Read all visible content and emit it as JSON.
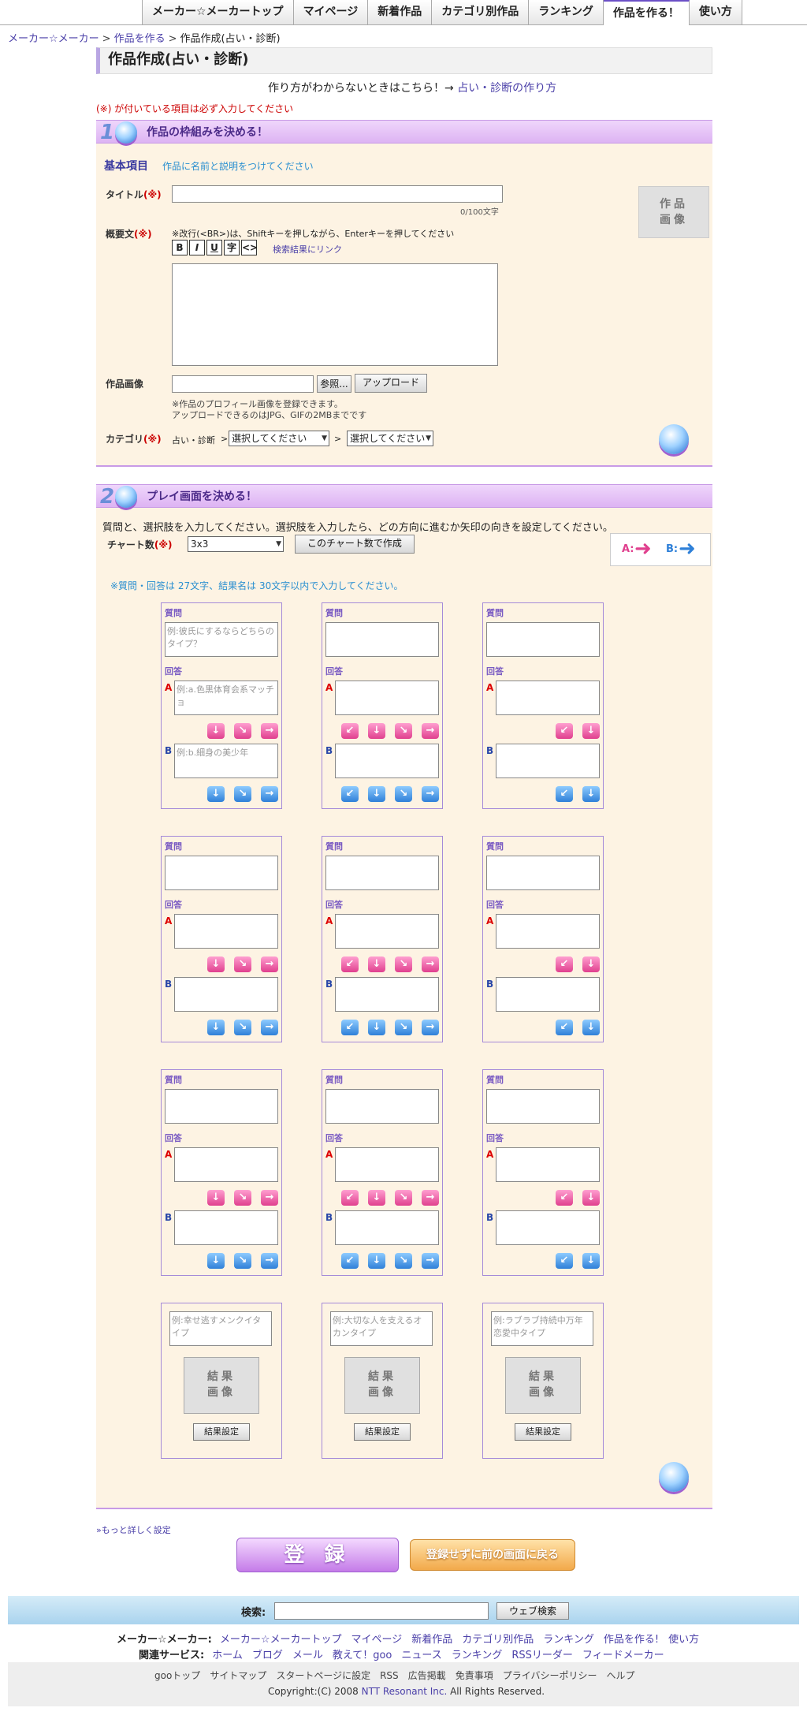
{
  "nav": {
    "tabs": [
      "メーカー☆メーカートップ",
      "マイページ",
      "新着作品",
      "カテゴリ別作品",
      "ランキング",
      "作品を作る！",
      "使い方"
    ],
    "active_index": 5
  },
  "breadcrumb": {
    "items": [
      "メーカー☆メーカー",
      "作品を作る"
    ],
    "current": "作品作成(占い・診断)",
    "sep": ">"
  },
  "page": {
    "title": "作品作成(占い・診断)",
    "howto_text": "作り方がわからないときはこちら！→",
    "howto_link": "占い・診断の作り方",
    "required_note": "(※) が付いている項目は必ず入力してください"
  },
  "section1": {
    "num": "1",
    "title": "作品の枠組みを決める！",
    "basic_label": "基本項目",
    "basic_hint": "作品に名前と説明をつけてください",
    "title_label": "タイトル",
    "req": "(※)",
    "title_counter": "0/100文字",
    "summary_label": "概要文",
    "summary_hint": "※改行(<BR>)は、Shiftキーを押しながら、Enterキーを押してください",
    "toolbar": [
      "B",
      "I",
      "U",
      "字",
      "<>"
    ],
    "search_link": "検索結果にリンク",
    "image_label": "作品画像",
    "browse_button": "参照...",
    "upload_button": "アップロード",
    "image_note1": "※作品のプロフィール画像を登録できます。",
    "image_note2": "アップロードできるのはJPG、GIFの2MBまでです",
    "category_label": "カテゴリ",
    "category_root": "占い・診断",
    "select_placeholder": "選択してください",
    "thumb_text": "作品\n画像"
  },
  "section2": {
    "num": "2",
    "title": "プレイ画面を決める！",
    "instruction": "質問と、選択肢を入力してください。選択肢を入力したら、どの方向に進むか矢印の向きを設定してください。",
    "chart_label": "チャート数",
    "chart_value": "3x3",
    "chart_button": "このチャート数で作成",
    "legend_a": "A:",
    "legend_b": "B:",
    "limit_note": "※質問・回答は 27文字、結果名は 30文字以内で入力してください。",
    "q_label": "質問",
    "a_label": "回答",
    "la": "A",
    "lb": "B",
    "example_q": "例:彼氏にするならどちらのタイプ？",
    "example_a": "例:a.色黒体育会系マッチョ",
    "example_b": "例:b.細身の美少年",
    "results": [
      {
        "placeholder": "例:幸せ逃すメンクイタイプ"
      },
      {
        "placeholder": "例:大切な人を支えるオカンタイプ"
      },
      {
        "placeholder": "例:ラブラブ持続中万年恋愛中タイプ"
      }
    ],
    "result_img": "結果\n画像",
    "result_button": "結果設定"
  },
  "more_settings": "»もっと詳しく設定",
  "register_button": "登 録",
  "back_button": "登録せずに前の画面に戻る",
  "footer": {
    "search_label": "検索:",
    "search_button": "ウェブ検索",
    "maker_label": "メーカー☆メーカー:",
    "maker_links": [
      "メーカー☆メーカートップ",
      "マイページ",
      "新着作品",
      "カテゴリ別作品",
      "ランキング",
      "作品を作る!",
      "使い方"
    ],
    "related_label": "関連サービス:",
    "related_links": [
      "ホーム",
      "ブログ",
      "メール",
      "教えて！goo",
      "ニュース",
      "ランキング",
      "RSSリーダー",
      "フィードメーカー"
    ],
    "bottom_links": [
      "gooトップ",
      "サイトマップ",
      "スタートページに設定",
      "RSS",
      "広告掲載",
      "免責事項",
      "プライバシーポリシー",
      "ヘルプ"
    ],
    "copyright_pre": "Copyright:(C) 2008",
    "copyright_link": "NTT Resonant Inc.",
    "copyright_post": "All Rights Reserved."
  },
  "colors": {
    "accent_purple": "#6b4fc6",
    "section_bg": "#fdf3e3",
    "pink_arrow": "#e0408e",
    "blue_arrow": "#2f80d8",
    "required_red": "#cc0000"
  }
}
